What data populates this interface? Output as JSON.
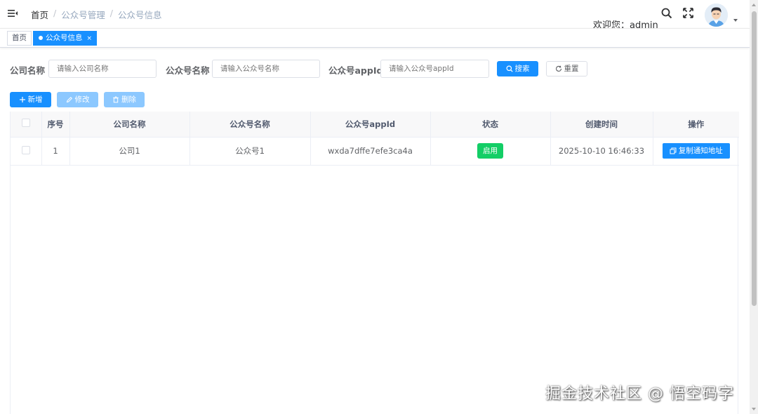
{
  "navbar": {
    "breadcrumb": [
      "首页",
      "公众号管理",
      "公众号信息"
    ],
    "separator": "/",
    "welcome": "欢迎您：admin"
  },
  "tags": {
    "home": "首页",
    "active": "公众号信息",
    "close": "×"
  },
  "search_form": {
    "company_label": "公司名称",
    "company_placeholder": "请输入公司名称",
    "account_label": "公众号名称",
    "account_placeholder": "请输入公众号名称",
    "appid_label": "公众号appId",
    "appid_placeholder": "请输入公众号appId",
    "search_label": "搜索",
    "reset_label": "重置"
  },
  "toolbar": {
    "add_label": "新增",
    "edit_label": "修改",
    "delete_label": "删除"
  },
  "table": {
    "columns": [
      "序号",
      "公司名称",
      "公众号名称",
      "公众号appId",
      "状态",
      "创建时间",
      "操作"
    ],
    "rows": [
      {
        "index": "1",
        "company": "公司1",
        "account": "公众号1",
        "appid": "wxda7dffe7efe3ca4a",
        "status": "启用",
        "created": "2025-10-10 16:46:33",
        "action": "复制通知地址"
      }
    ]
  },
  "watermark": "掘金技术社区 @ 悟空码字",
  "colors": {
    "primary": "#1890ff",
    "success": "#13ce66",
    "disabled": "#8cc8ff"
  }
}
